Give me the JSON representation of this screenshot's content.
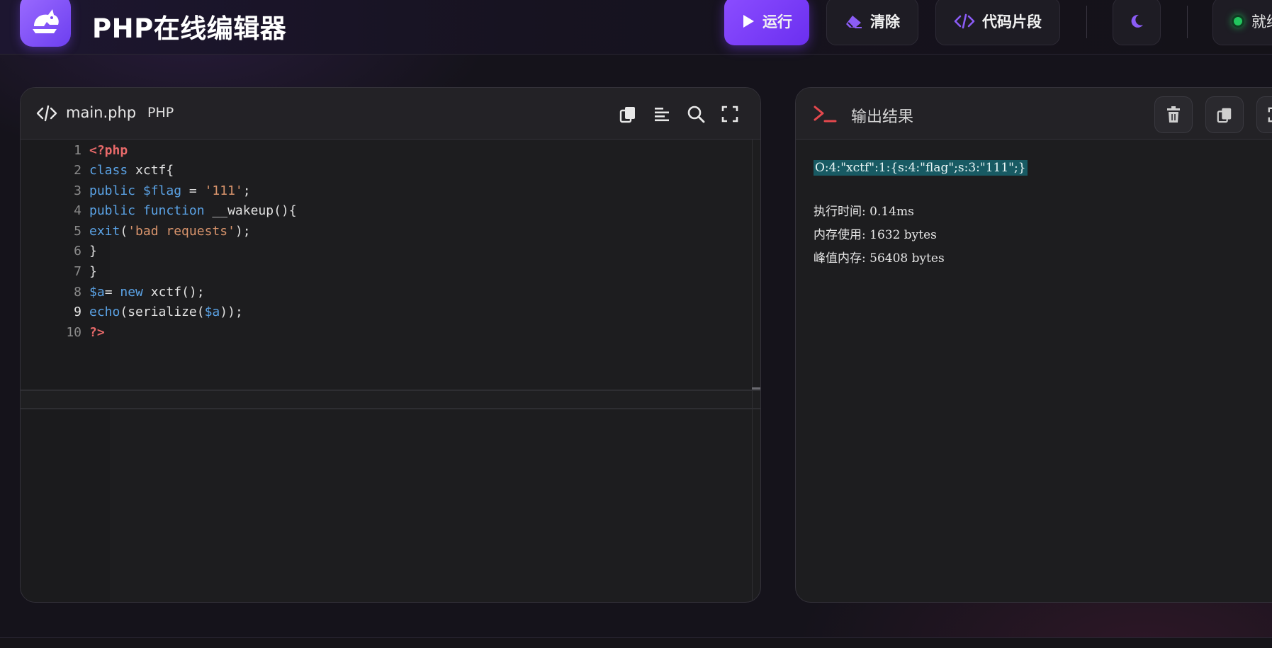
{
  "header": {
    "title": "PHP在线编辑器",
    "run_label": "运行",
    "clear_label": "清除",
    "snippets_label": "代码片段",
    "status_label": "就绪"
  },
  "editor": {
    "filename": "main.php",
    "language": "PHP",
    "active_line": 9,
    "line_numbers": [
      "1",
      "2",
      "3",
      "4",
      "5",
      "6",
      "7",
      "8",
      "9",
      "10"
    ],
    "code": [
      "<?php",
      "class xctf{",
      "public $flag = '111';",
      "public function __wakeup(){",
      "exit('bad requests');",
      "}",
      "}",
      "$a= new xctf();",
      "echo(serialize($a));",
      "?>"
    ]
  },
  "output": {
    "title": "输出结果",
    "result": "O:4:\"xctf\":1:{s:4:\"flag\";s:3:\"111\";}",
    "exec_time": "执行时间: 0.14ms",
    "memory": "内存使用: 1632 bytes",
    "peak_memory": "峰值内存: 56408 bytes"
  },
  "colors": {
    "accent": "#7c3aed",
    "status_ready": "#22c55e",
    "keyword": "#5ba3e6",
    "string": "#d9946c",
    "php_tag": "#e96a6a",
    "highlight": "#185a63",
    "terminal_icon": "#e5484d"
  },
  "icons": {
    "logo": "php-elephant-logo",
    "run": "play-icon",
    "clear": "eraser-icon",
    "snippets": "code-icon",
    "theme": "moon-icon",
    "copy": "copy-icon",
    "format": "align-left-icon",
    "search": "search-icon",
    "fullscreen": "fullscreen-icon",
    "terminal": "terminal-icon",
    "trash": "trash-icon"
  }
}
